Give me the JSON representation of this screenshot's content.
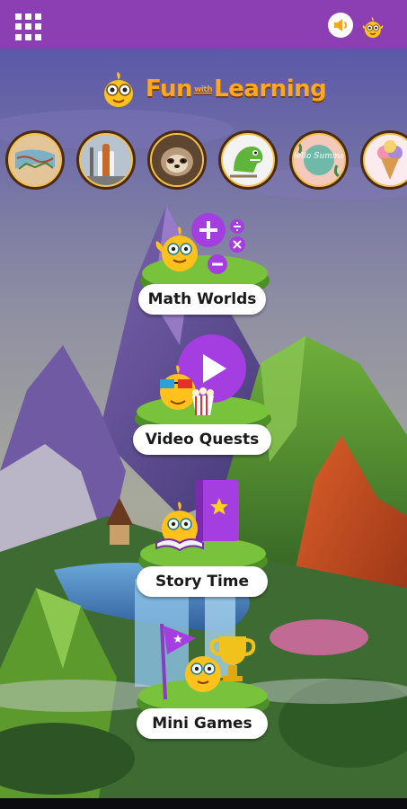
{
  "app": {
    "logo_fun": "Fun",
    "logo_with": "with",
    "logo_learning": "Learning"
  },
  "topbar": {
    "menu_icon": "grid-menu-icon",
    "sound_icon": "speaker-icon",
    "profile_icon": "mascot-profile-icon",
    "color": "#8b3fb3"
  },
  "topics": [
    {
      "name": "topic-maps",
      "icon": "map-illustration"
    },
    {
      "name": "topic-space-shuttle",
      "icon": "space-shuttle-photo"
    },
    {
      "name": "topic-sloth",
      "icon": "sloth-photo"
    },
    {
      "name": "topic-dinosaur",
      "icon": "dinosaur-illustration"
    },
    {
      "name": "topic-hello-summer",
      "text": "Hello Summer"
    },
    {
      "name": "topic-ice-cream",
      "icon": "ice-cream-illustration"
    }
  ],
  "menu": {
    "math_worlds": "Math Worlds",
    "video_quests": "Video Quests",
    "story_time": "Story Time",
    "mini_games": "Mini Games"
  },
  "colors": {
    "accent_purple": "#8b3fb3",
    "bright_purple": "#a53ee0",
    "mascot_yellow": "#ffc21c",
    "logo_orange": "#ffa81f",
    "grass_green": "#5aa82e"
  }
}
